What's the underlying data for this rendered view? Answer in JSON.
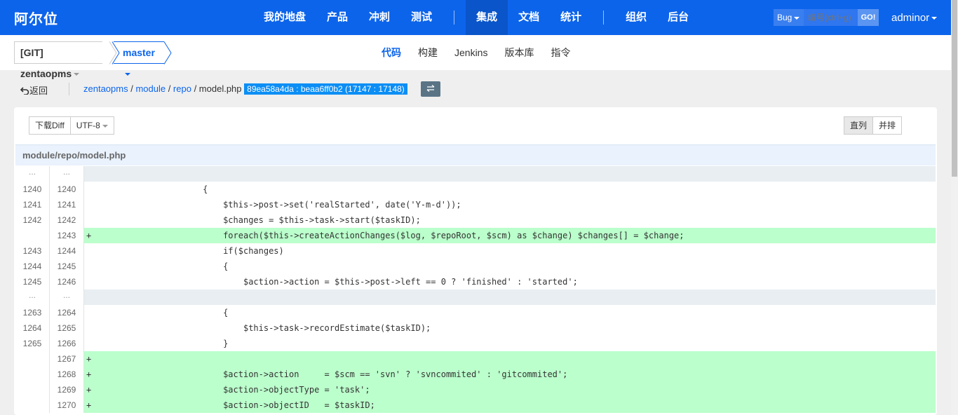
{
  "header": {
    "brand": "阿尔位",
    "nav": [
      "我的地盘",
      "产品",
      "冲刺",
      "测试",
      "集成",
      "文档",
      "统计",
      "组织",
      "后台"
    ],
    "active_nav": "集成",
    "search": {
      "type": "Bug",
      "placeholder": "编号(ctrl+g)",
      "go": "GO!"
    },
    "user": "adminor"
  },
  "subheader": {
    "repo": "[GIT] zentaopms",
    "branch": "master",
    "tabs": [
      "代码",
      "构建",
      "Jenkins",
      "版本库",
      "指令"
    ],
    "active_tab": "代码"
  },
  "breadcrumb": {
    "back": "返回",
    "path": [
      "zentaopms",
      "module",
      "repo"
    ],
    "file": "model.php",
    "revision": "89ea58a4da : beaa6ff0b2 (17147 : 17148)",
    "swap_icon": "exchange-icon"
  },
  "toolbar": {
    "download": "下载Diff",
    "encoding": "UTF-8",
    "view_inline": "直列",
    "view_side": "并排"
  },
  "file_path": "module/repo/model.php",
  "diff_lines": [
    {
      "type": "skip",
      "old": "...",
      "new": "...",
      "code": ""
    },
    {
      "type": "ctx",
      "old": "1240",
      "new": "1240",
      "code": "                       {"
    },
    {
      "type": "ctx",
      "old": "1241",
      "new": "1241",
      "code": "                           $this->post->set('realStarted', date('Y-m-d'));"
    },
    {
      "type": "ctx",
      "old": "1242",
      "new": "1242",
      "code": "                           $changes = $this->task->start($taskID);"
    },
    {
      "type": "add",
      "old": "",
      "new": "1243",
      "code": "+                          foreach($this->createActionChanges($log, $repoRoot, $scm) as $change) $changes[] = $change;"
    },
    {
      "type": "ctx",
      "old": "1243",
      "new": "1244",
      "code": "                           if($changes)"
    },
    {
      "type": "ctx",
      "old": "1244",
      "new": "1245",
      "code": "                           {"
    },
    {
      "type": "ctx",
      "old": "1245",
      "new": "1246",
      "code": "                               $action->action = $this->post->left == 0 ? 'finished' : 'started';"
    },
    {
      "type": "skip",
      "old": "...",
      "new": "...",
      "code": ""
    },
    {
      "type": "ctx",
      "old": "1263",
      "new": "1264",
      "code": "                           {"
    },
    {
      "type": "ctx",
      "old": "1264",
      "new": "1265",
      "code": "                               $this->task->recordEstimate($taskID);"
    },
    {
      "type": "ctx",
      "old": "1265",
      "new": "1266",
      "code": "                           }"
    },
    {
      "type": "add",
      "old": "",
      "new": "1267",
      "code": "+"
    },
    {
      "type": "add",
      "old": "",
      "new": "1268",
      "code": "+                          $action->action     = $scm == 'svn' ? 'svncommited' : 'gitcommited';"
    },
    {
      "type": "add",
      "old": "",
      "new": "1269",
      "code": "+                          $action->objectType = 'task';"
    },
    {
      "type": "add",
      "old": "",
      "new": "1270",
      "code": "+                          $action->objectID   = $taskID;"
    }
  ]
}
